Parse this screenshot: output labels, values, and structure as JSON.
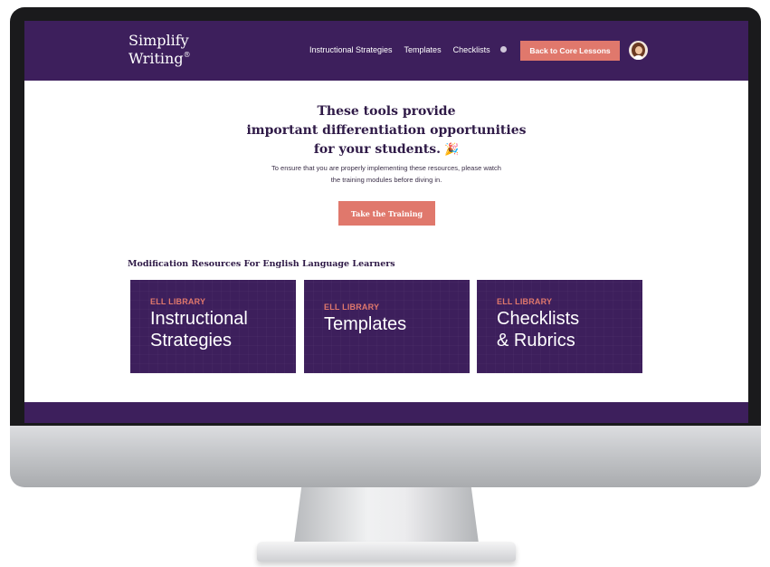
{
  "header": {
    "logo_line1": "Simplify",
    "logo_line2": "Writing",
    "logo_mark": "®",
    "nav_links": [
      "Instructional Strategies",
      "Templates",
      "Checklists"
    ],
    "search_icon": "search-icon",
    "back_button": "Back to Core Lessons",
    "avatar_icon": "user-avatar"
  },
  "hero": {
    "headline_lines": [
      "These tools provide",
      "important differentiation opportunities",
      "for your students."
    ],
    "headline_icon": "🎉",
    "intro_lines": [
      "To ensure that you are properly implementing these resources, please watch",
      "the training modules before diving in."
    ],
    "cta": "Take the Training"
  },
  "resources": {
    "section_title": "Modification Resources For English Language Learners",
    "cards": [
      {
        "kicker": "ELL LIBRARY",
        "title_lines": [
          "Instructional",
          "Strategies"
        ]
      },
      {
        "kicker": "ELL LIBRARY",
        "title_lines": [
          "Templates"
        ]
      },
      {
        "kicker": "ELL LIBRARY",
        "title_lines": [
          "Checklists",
          "& Rubrics"
        ]
      }
    ]
  },
  "colors": {
    "brand_purple": "#3d1f5c",
    "accent_coral": "#e0786c",
    "heading_text": "#2f1a47"
  }
}
